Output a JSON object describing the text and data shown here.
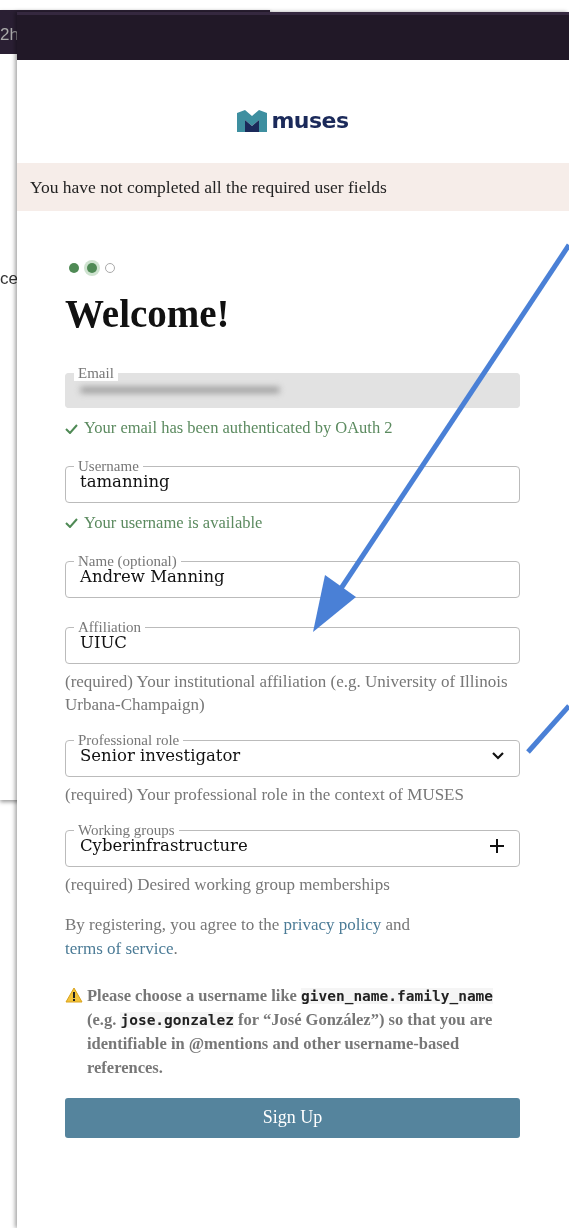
{
  "back_window": {
    "fragments": [
      "2h",
      "ce"
    ]
  },
  "logo": {
    "text": "muses"
  },
  "alert": {
    "text": "You have not completed all the required user fields"
  },
  "steps": [
    {
      "done": true,
      "current": false
    },
    {
      "done": true,
      "current": true
    },
    {
      "done": false,
      "current": false
    }
  ],
  "heading": "Welcome!",
  "fields": [
    {
      "kind": "readonly",
      "label": "Email",
      "value_redacted": true,
      "success": "Your email has been authenticated by OAuth 2"
    },
    {
      "kind": "text",
      "label": "Username",
      "value": "tamanning",
      "success": "Your username is available"
    },
    {
      "kind": "text",
      "label": "Name (optional)",
      "value": "Andrew Manning"
    },
    {
      "kind": "text",
      "label": "Affiliation",
      "value": "UIUC",
      "help": "(required) Your institutional affiliation (e.g. University of Illinois Urbana-Champaign)"
    },
    {
      "kind": "select",
      "label": "Professional role",
      "value": "Senior investigator",
      "help": "(required) Your professional role in the context of MUSES"
    },
    {
      "kind": "multi",
      "label": "Working groups",
      "value": "Cyberinfrastructure",
      "help": "(required) Desired working group memberships"
    }
  ],
  "agreement": [
    {
      "kind": "text",
      "text": "By registering, you agree to the "
    },
    {
      "kind": "link",
      "text": "privacy policy"
    },
    {
      "kind": "text",
      "text": " and "
    },
    {
      "kind": "link",
      "text": "terms of service"
    },
    {
      "kind": "text",
      "text": "."
    }
  ],
  "warning": [
    {
      "kind": "text",
      "text": "Please choose a username like "
    },
    {
      "kind": "code",
      "text": "given_name.family_name"
    },
    {
      "kind": "text",
      "text": " (e.g. "
    },
    {
      "kind": "code",
      "text": "jose.gonzalez"
    },
    {
      "kind": "text",
      "text": " for “José González”) so that you are identifiable in @mentions and other username-based references."
    }
  ],
  "submit": {
    "label": "Sign Up"
  }
}
